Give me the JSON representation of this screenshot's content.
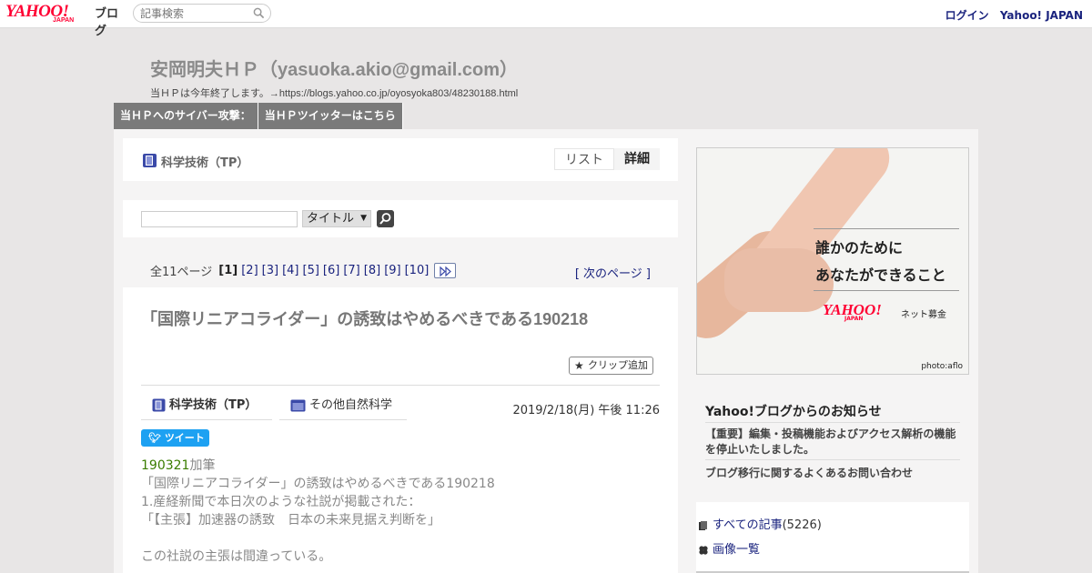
{
  "topbar": {
    "logo_text": "YAHOO!",
    "logo_sub": "JAPAN",
    "logo_blog": "ブログ",
    "search_placeholder": "記事検索",
    "login": "ログイン",
    "yahoo_japan": "Yahoo! JAPAN"
  },
  "header": {
    "title": "安岡明夫ＨＰ（yasuoka.akio@gmail.com）",
    "description": "当ＨＰは今年終了します。→https://blogs.yahoo.co.jp/oyosyoka803/48230188.html"
  },
  "nav": [
    {
      "label": "当ＨＰへのサイバー攻撃："
    },
    {
      "label": "当ＨＰツイッターはこちら"
    }
  ],
  "category_box": {
    "label": "科学技術（TP）",
    "view_list": "リスト",
    "view_detail": "詳細"
  },
  "article_search": {
    "query": "",
    "selected_field": "タイトル"
  },
  "pager": {
    "total": "全11ページ",
    "current": "[1]",
    "pages": [
      "[2]",
      "[3]",
      "[4]",
      "[5]",
      "[6]",
      "[7]",
      "[8]",
      "[9]",
      "[10]"
    ],
    "next": "[ 次のページ ]"
  },
  "post": {
    "title": "「国際リニアコライダー」の誘致はやめるべきである190218",
    "clip": "クリップ追加",
    "category": "科学技術（TP）",
    "subcategory": "その他自然科学",
    "date": "2019/2/18(月) 午後 11:26",
    "tweet": "ツイート",
    "body_lead_green": "190321",
    "body_lead_rest": "加筆",
    "body_lines": [
      "「国際リニアコライダー」の誘致はやめるべきである190218",
      "1.産経新聞で本日次のような社説が掲載された：",
      "「【主張】加速器の誘致　日本の未来見据え判断を」",
      "",
      "この社説の主張は間違っている。"
    ]
  },
  "sidebar": {
    "ad_copy_1": "誰かのために",
    "ad_copy_2": "あなたができること",
    "ad_logo": "YAHOO!",
    "ad_logo_sub": "JAPAN",
    "ad_service": "ネット募金",
    "ad_credit": "photo:aflo",
    "notice_title": "Yahoo!ブログからのお知らせ",
    "notice_1": "【重要】編集・投稿機能およびアクセス解析の機能を停止いたしました。",
    "notice_2": "ブログ移行に関するよくあるお問い合わせ",
    "all_posts_label": "すべての記事",
    "all_posts_count": "(5226)",
    "images_label": "画像一覧"
  }
}
